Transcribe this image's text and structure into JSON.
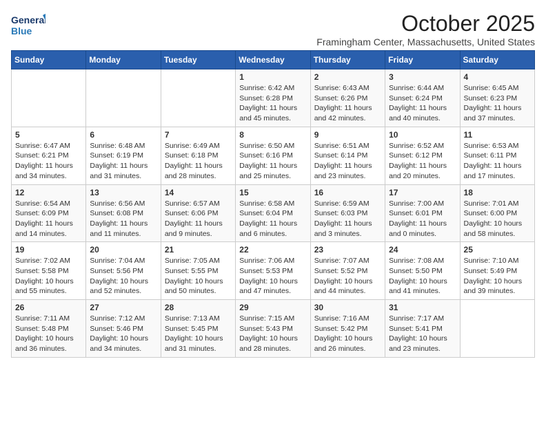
{
  "logo": {
    "line1": "General",
    "line2": "Blue"
  },
  "title": "October 2025",
  "subtitle": "Framingham Center, Massachusetts, United States",
  "days_of_week": [
    "Sunday",
    "Monday",
    "Tuesday",
    "Wednesday",
    "Thursday",
    "Friday",
    "Saturday"
  ],
  "weeks": [
    [
      {
        "day": "",
        "info": ""
      },
      {
        "day": "",
        "info": ""
      },
      {
        "day": "",
        "info": ""
      },
      {
        "day": "1",
        "info": "Sunrise: 6:42 AM\nSunset: 6:28 PM\nDaylight: 11 hours\nand 45 minutes."
      },
      {
        "day": "2",
        "info": "Sunrise: 6:43 AM\nSunset: 6:26 PM\nDaylight: 11 hours\nand 42 minutes."
      },
      {
        "day": "3",
        "info": "Sunrise: 6:44 AM\nSunset: 6:24 PM\nDaylight: 11 hours\nand 40 minutes."
      },
      {
        "day": "4",
        "info": "Sunrise: 6:45 AM\nSunset: 6:23 PM\nDaylight: 11 hours\nand 37 minutes."
      }
    ],
    [
      {
        "day": "5",
        "info": "Sunrise: 6:47 AM\nSunset: 6:21 PM\nDaylight: 11 hours\nand 34 minutes."
      },
      {
        "day": "6",
        "info": "Sunrise: 6:48 AM\nSunset: 6:19 PM\nDaylight: 11 hours\nand 31 minutes."
      },
      {
        "day": "7",
        "info": "Sunrise: 6:49 AM\nSunset: 6:18 PM\nDaylight: 11 hours\nand 28 minutes."
      },
      {
        "day": "8",
        "info": "Sunrise: 6:50 AM\nSunset: 6:16 PM\nDaylight: 11 hours\nand 25 minutes."
      },
      {
        "day": "9",
        "info": "Sunrise: 6:51 AM\nSunset: 6:14 PM\nDaylight: 11 hours\nand 23 minutes."
      },
      {
        "day": "10",
        "info": "Sunrise: 6:52 AM\nSunset: 6:12 PM\nDaylight: 11 hours\nand 20 minutes."
      },
      {
        "day": "11",
        "info": "Sunrise: 6:53 AM\nSunset: 6:11 PM\nDaylight: 11 hours\nand 17 minutes."
      }
    ],
    [
      {
        "day": "12",
        "info": "Sunrise: 6:54 AM\nSunset: 6:09 PM\nDaylight: 11 hours\nand 14 minutes."
      },
      {
        "day": "13",
        "info": "Sunrise: 6:56 AM\nSunset: 6:08 PM\nDaylight: 11 hours\nand 11 minutes."
      },
      {
        "day": "14",
        "info": "Sunrise: 6:57 AM\nSunset: 6:06 PM\nDaylight: 11 hours\nand 9 minutes."
      },
      {
        "day": "15",
        "info": "Sunrise: 6:58 AM\nSunset: 6:04 PM\nDaylight: 11 hours\nand 6 minutes."
      },
      {
        "day": "16",
        "info": "Sunrise: 6:59 AM\nSunset: 6:03 PM\nDaylight: 11 hours\nand 3 minutes."
      },
      {
        "day": "17",
        "info": "Sunrise: 7:00 AM\nSunset: 6:01 PM\nDaylight: 11 hours\nand 0 minutes."
      },
      {
        "day": "18",
        "info": "Sunrise: 7:01 AM\nSunset: 6:00 PM\nDaylight: 10 hours\nand 58 minutes."
      }
    ],
    [
      {
        "day": "19",
        "info": "Sunrise: 7:02 AM\nSunset: 5:58 PM\nDaylight: 10 hours\nand 55 minutes."
      },
      {
        "day": "20",
        "info": "Sunrise: 7:04 AM\nSunset: 5:56 PM\nDaylight: 10 hours\nand 52 minutes."
      },
      {
        "day": "21",
        "info": "Sunrise: 7:05 AM\nSunset: 5:55 PM\nDaylight: 10 hours\nand 50 minutes."
      },
      {
        "day": "22",
        "info": "Sunrise: 7:06 AM\nSunset: 5:53 PM\nDaylight: 10 hours\nand 47 minutes."
      },
      {
        "day": "23",
        "info": "Sunrise: 7:07 AM\nSunset: 5:52 PM\nDaylight: 10 hours\nand 44 minutes."
      },
      {
        "day": "24",
        "info": "Sunrise: 7:08 AM\nSunset: 5:50 PM\nDaylight: 10 hours\nand 41 minutes."
      },
      {
        "day": "25",
        "info": "Sunrise: 7:10 AM\nSunset: 5:49 PM\nDaylight: 10 hours\nand 39 minutes."
      }
    ],
    [
      {
        "day": "26",
        "info": "Sunrise: 7:11 AM\nSunset: 5:48 PM\nDaylight: 10 hours\nand 36 minutes."
      },
      {
        "day": "27",
        "info": "Sunrise: 7:12 AM\nSunset: 5:46 PM\nDaylight: 10 hours\nand 34 minutes."
      },
      {
        "day": "28",
        "info": "Sunrise: 7:13 AM\nSunset: 5:45 PM\nDaylight: 10 hours\nand 31 minutes."
      },
      {
        "day": "29",
        "info": "Sunrise: 7:15 AM\nSunset: 5:43 PM\nDaylight: 10 hours\nand 28 minutes."
      },
      {
        "day": "30",
        "info": "Sunrise: 7:16 AM\nSunset: 5:42 PM\nDaylight: 10 hours\nand 26 minutes."
      },
      {
        "day": "31",
        "info": "Sunrise: 7:17 AM\nSunset: 5:41 PM\nDaylight: 10 hours\nand 23 minutes."
      },
      {
        "day": "",
        "info": ""
      }
    ]
  ]
}
